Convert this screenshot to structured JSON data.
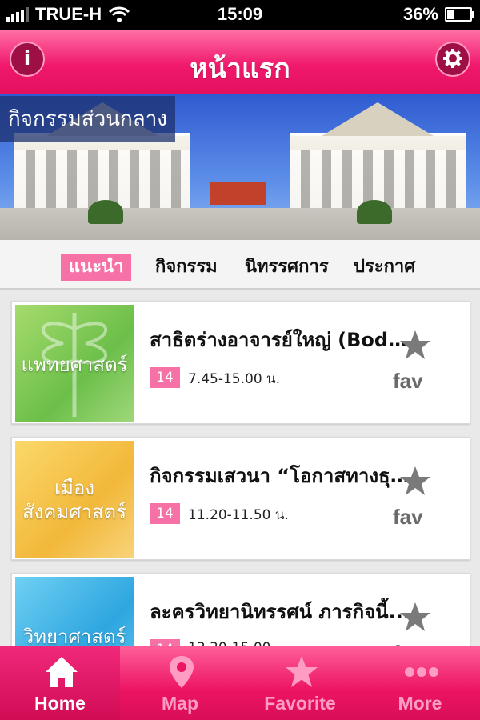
{
  "status_bar": {
    "carrier": "TRUE-H",
    "time": "15:09",
    "battery": "36%",
    "battery_level": 0.36
  },
  "nav": {
    "title": "หน้าแรก",
    "info_icon": "info-icon",
    "settings_icon": "gear-icon"
  },
  "banner": {
    "label": "กิจกรรมส่วนกลาง"
  },
  "tabs": [
    {
      "label": "แนะนำ",
      "active": true
    },
    {
      "label": "กิจกรรม",
      "active": false
    },
    {
      "label": "นิทรรศการ",
      "active": false
    },
    {
      "label": "ประกาศ",
      "active": false
    }
  ],
  "events": [
    {
      "thumb_label": "แพทยศาสตร์",
      "title": "สาธิตร่างอาจารย์ใหญ่ (Body Donation)",
      "day": "14",
      "time": "7.45-15.00 น.",
      "fav_label": "fav",
      "accent": "#8ccf5e"
    },
    {
      "thumb_label": "เมือง สังคมศาสตร์",
      "title": "กิจกรรมเสวนา “โอกาสทางธุรกิจ”",
      "day": "14",
      "time": "11.20-11.50 น.",
      "fav_label": "fav",
      "accent": "#f5c54a"
    },
    {
      "thumb_label": "วิทยาศาสตร์",
      "title": "ละครวิทยานิทรรศน์ ภารกิจนี้...",
      "day": "14",
      "time": "13.30-15.00",
      "fav_label": "fav",
      "accent": "#3fb3e6"
    }
  ],
  "tab_bar": [
    {
      "label": "Home",
      "icon": "home-icon",
      "active": true
    },
    {
      "label": "Map",
      "icon": "map-pin-icon",
      "active": false
    },
    {
      "label": "Favorite",
      "icon": "star-icon",
      "active": false
    },
    {
      "label": "More",
      "icon": "more-dots-icon",
      "active": false
    }
  ],
  "colors": {
    "brand_pink": "#f0186b",
    "tab_active": "#f571a6"
  }
}
